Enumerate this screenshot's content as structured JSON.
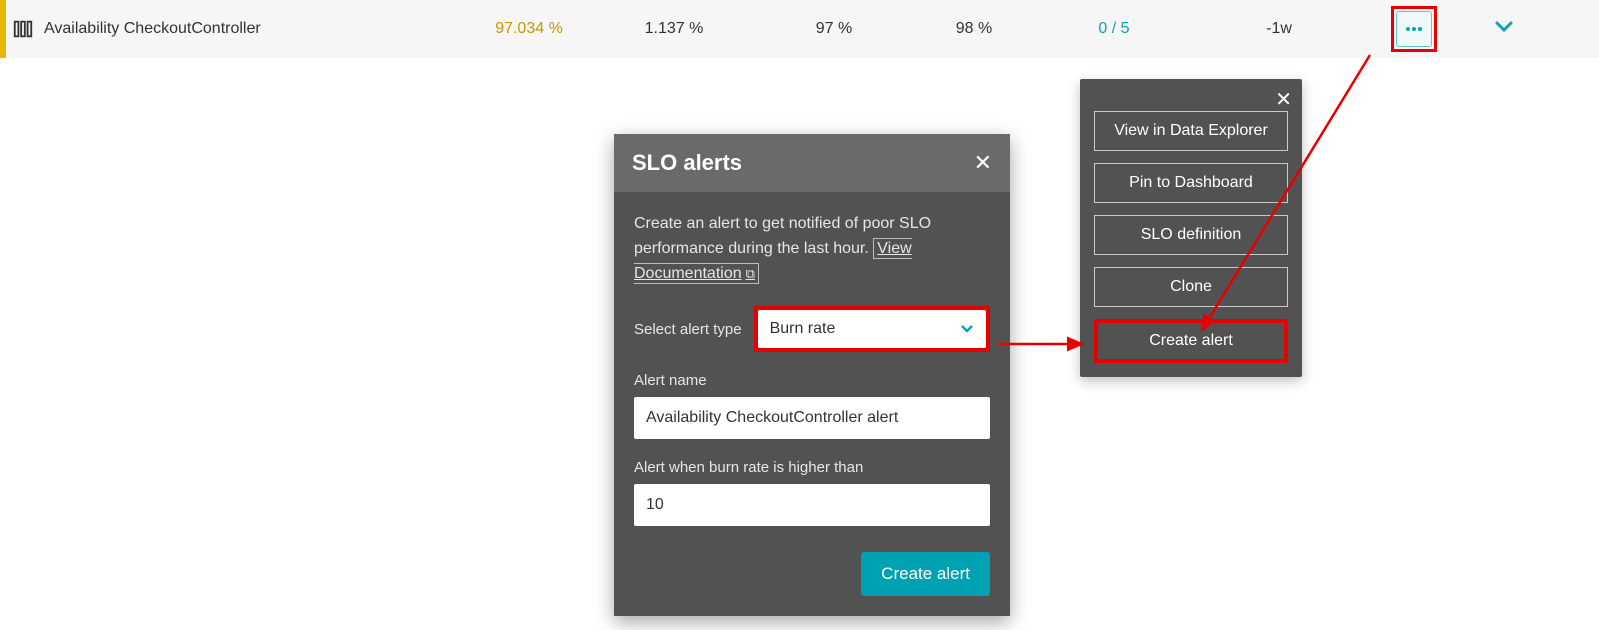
{
  "row": {
    "name": "Availability CheckoutController",
    "value_pct": "97.034 %",
    "error_budget": "1.137 %",
    "warning": "97 %",
    "target": "98 %",
    "problems": "0 / 5",
    "window": "-1w"
  },
  "menu": {
    "items": {
      "view_explorer": "View in Data Explorer",
      "pin_dashboard": "Pin to Dashboard",
      "slo_definition": "SLO definition",
      "clone": "Clone",
      "create_alert": "Create alert"
    }
  },
  "dialog": {
    "title": "SLO alerts",
    "description": "Create an alert to get notified of poor SLO performance during the last hour.",
    "doc_link": "View Documentation",
    "select_label": "Select alert type",
    "select_value": "Burn rate",
    "alert_name_label": "Alert name",
    "alert_name_value": "Availability CheckoutController alert",
    "threshold_label": "Alert when burn rate is higher than",
    "threshold_value": "10",
    "create_button": "Create alert"
  }
}
